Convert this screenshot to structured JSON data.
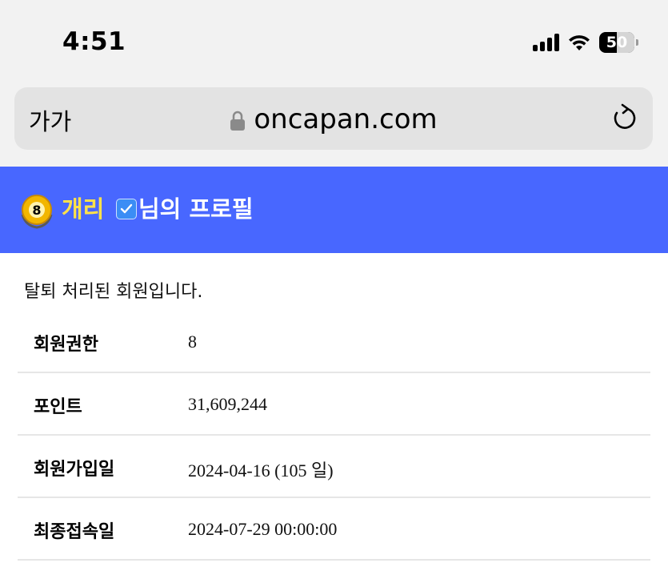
{
  "status_bar": {
    "time": "4:51",
    "battery": "50",
    "icons": [
      "cellular-signal-icon",
      "wifi-icon",
      "battery-icon"
    ]
  },
  "browser": {
    "text_size_label": "가가",
    "url": "oncapan.com",
    "icons": [
      "lock-icon",
      "reload-icon"
    ]
  },
  "profile_header": {
    "level_badge": "8",
    "nickname": "개리",
    "title_suffix": "님의 프로필",
    "background_color": "#4867ff",
    "nickname_color": "#ffe14a"
  },
  "notice": "탈퇴 처리된 회원입니다.",
  "info_rows": [
    {
      "label": "회원권한",
      "value": "8"
    },
    {
      "label": "포인트",
      "value": "31,609,244"
    },
    {
      "label": "회원가입일",
      "value": "2024-04-16 (105 일)"
    },
    {
      "label": "최종접속일",
      "value": "2024-07-29 00:00:00"
    }
  ]
}
